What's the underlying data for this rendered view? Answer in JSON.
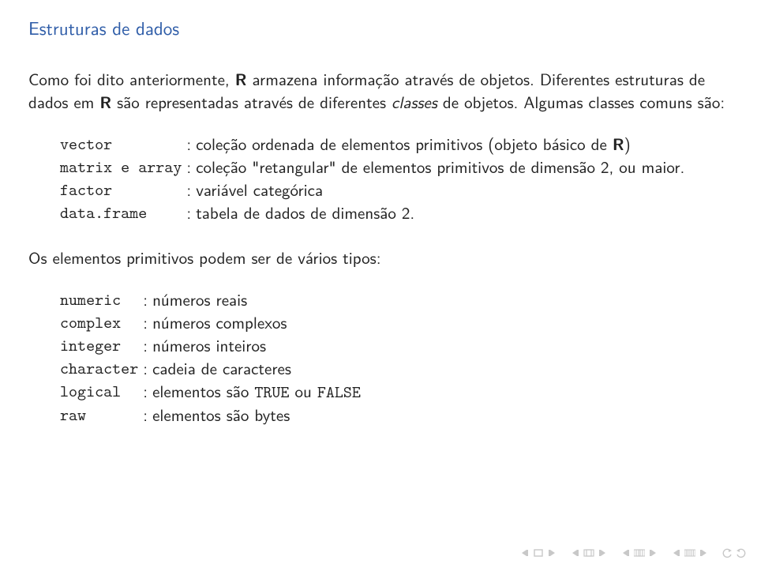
{
  "title": "Estruturas de dados",
  "para1_a": "Como foi dito anteriormente, ",
  "para1_b": "R",
  "para1_c": " armazena informação através de objetos. Diferentes estruturas de dados em ",
  "para1_d": "R",
  "para1_e": " são representadas através de diferentes ",
  "para1_f": "classes",
  "para1_g": " de objetos. Algumas classes comuns são:",
  "classes": [
    {
      "name": "vector",
      "sep": ":",
      "desc_a": "coleção ordenada de elementos primitivos (objeto básico de ",
      "desc_b": "R",
      "desc_c": ")"
    },
    {
      "name": "matrix e array",
      "sep": ":",
      "desc_a": "coleção \"retangular\" de elementos primitivos de dimensão 2, ou maior.",
      "desc_b": "",
      "desc_c": ""
    },
    {
      "name": "factor",
      "sep": ":",
      "desc_a": "variável categórica",
      "desc_b": "",
      "desc_c": ""
    },
    {
      "name": "data.frame",
      "sep": ":",
      "desc_a": "tabela de dados de dimensão 2.",
      "desc_b": "",
      "desc_c": ""
    }
  ],
  "para2": "Os elementos primitivos podem ser de vários tipos:",
  "types": [
    {
      "name": "numeric",
      "sep": ":",
      "desc": "números reais"
    },
    {
      "name": "complex",
      "sep": ":",
      "desc": "números complexos"
    },
    {
      "name": "integer",
      "sep": ":",
      "desc": "números inteiros"
    },
    {
      "name": "character",
      "sep": ":",
      "desc": "cadeia de caracteres"
    },
    {
      "name": "logical",
      "sep": ":",
      "desc_a": "elementos são ",
      "tt1": "TRUE",
      "mid": " ou ",
      "tt2": "FALSE"
    },
    {
      "name": "raw",
      "sep": ":",
      "desc": "elementos são bytes"
    }
  ],
  "nav_icons": {
    "slide_prev": "slide-prev",
    "slide_next": "slide-next",
    "frame_prev": "frame-prev",
    "frame_next": "frame-next",
    "sect_prev": "section-prev",
    "sect_next": "section-next",
    "undo": "undo-icon",
    "redo": "redo-icon"
  }
}
